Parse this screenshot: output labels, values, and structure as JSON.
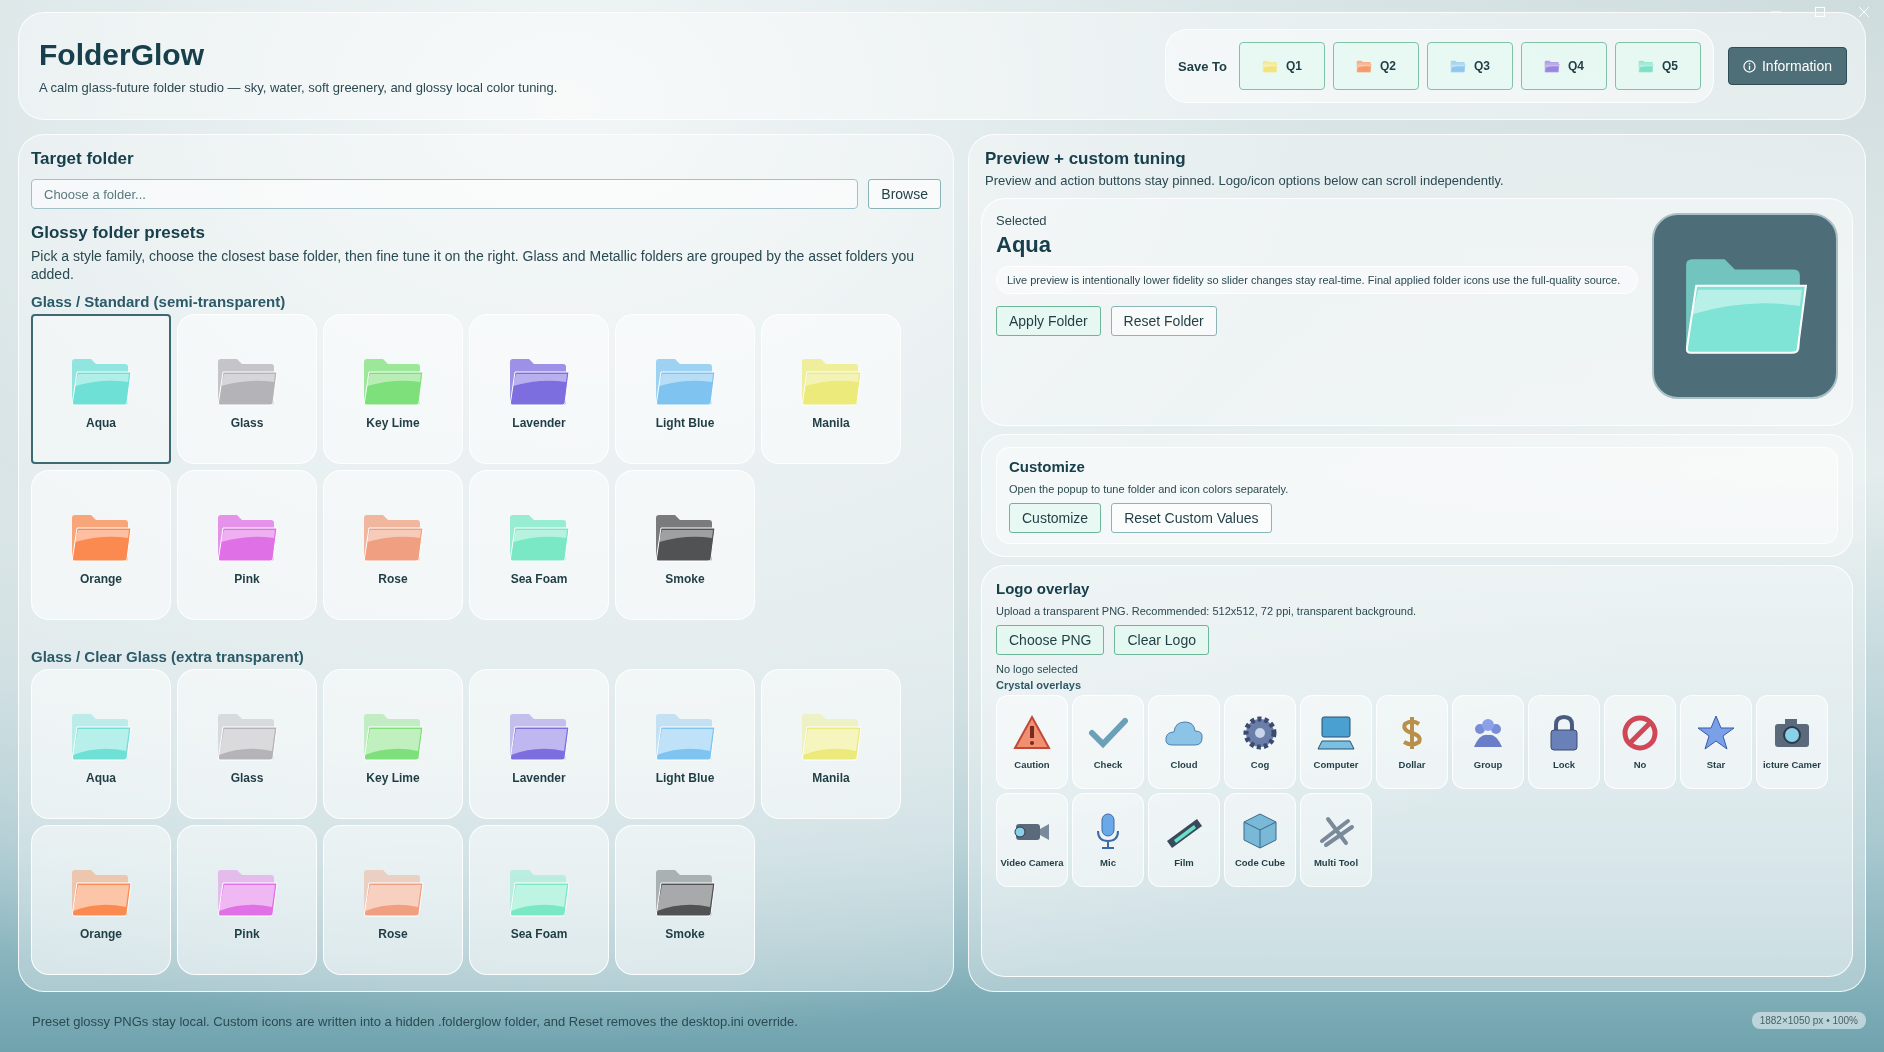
{
  "app": {
    "title": "FolderGlow",
    "subtitle": "A calm glass-future folder studio — sky, water, soft greenery, and glossy local color tuning."
  },
  "save_to": {
    "label": "Save To",
    "slots": [
      {
        "label": "Q1",
        "color": "#f2e37a"
      },
      {
        "label": "Q2",
        "color": "#f59a6a"
      },
      {
        "label": "Q3",
        "color": "#8fc8ec"
      },
      {
        "label": "Q4",
        "color": "#9a86e0"
      },
      {
        "label": "Q5",
        "color": "#7fe0c8"
      }
    ]
  },
  "info_button": "Information",
  "target_folder": {
    "title": "Target folder",
    "placeholder": "Choose a folder...",
    "browse": "Browse"
  },
  "presets": {
    "title": "Glossy folder presets",
    "description": "Pick a style family, choose the closest base folder, then fine tune it on the right. Glass and Metallic folders are grouped by the asset folders you added.",
    "groups": [
      {
        "title": "Glass / Standard (semi-transparent)",
        "kind": "standard",
        "items": [
          {
            "label": "Aqua",
            "color": "#6fe0d6",
            "selected": true
          },
          {
            "label": "Glass",
            "color": "#b4b4b8",
            "selected": false
          },
          {
            "label": "Key Lime",
            "color": "#7ee07a",
            "selected": false
          },
          {
            "label": "Lavender",
            "color": "#7d6ee0",
            "selected": false
          },
          {
            "label": "Light Blue",
            "color": "#7fc4f0",
            "selected": false
          },
          {
            "label": "Manila",
            "color": "#ecea7a",
            "selected": false
          },
          {
            "label": "Orange",
            "color": "#fb8a50",
            "selected": false
          },
          {
            "label": "Pink",
            "color": "#e070e6",
            "selected": false
          },
          {
            "label": "Rose",
            "color": "#f0a080",
            "selected": false
          },
          {
            "label": "Sea Foam",
            "color": "#7ae8c4",
            "selected": false
          },
          {
            "label": "Smoke",
            "color": "#505254",
            "selected": false
          }
        ]
      },
      {
        "title": "Glass / Clear Glass (extra transparent)",
        "kind": "clear",
        "items": [
          {
            "label": "Aqua",
            "color": "#6fe0d6",
            "selected": false
          },
          {
            "label": "Glass",
            "color": "#b4b4b8",
            "selected": false
          },
          {
            "label": "Key Lime",
            "color": "#7ee07a",
            "selected": false
          },
          {
            "label": "Lavender",
            "color": "#7d6ee0",
            "selected": false
          },
          {
            "label": "Light Blue",
            "color": "#7fc4f0",
            "selected": false
          },
          {
            "label": "Manila",
            "color": "#ecea7a",
            "selected": false
          },
          {
            "label": "Orange",
            "color": "#fb8a50",
            "selected": false
          },
          {
            "label": "Pink",
            "color": "#e070e6",
            "selected": false
          },
          {
            "label": "Rose",
            "color": "#f0a080",
            "selected": false
          },
          {
            "label": "Sea Foam",
            "color": "#7ae8c4",
            "selected": false
          },
          {
            "label": "Smoke",
            "color": "#505254",
            "selected": false
          }
        ]
      }
    ]
  },
  "preview": {
    "title": "Preview + custom tuning",
    "description": "Preview and action buttons stay pinned. Logo/icon options below can scroll independently.",
    "selected_label": "Selected",
    "selected_name": "Aqua",
    "note": "Live preview is intentionally lower fidelity so slider changes stay real-time. Final applied folder icons use the full-quality source.",
    "buttons": [
      "Apply Folder",
      "Reset Folder"
    ],
    "color": "#7fe3d6"
  },
  "customize": {
    "title": "Customize",
    "description": "Open the popup to tune folder and icon colors separately.",
    "buttons": [
      "Customize",
      "Reset Custom Values"
    ]
  },
  "logo_overlay": {
    "title": "Logo overlay",
    "description": "Upload a transparent PNG. Recommended: 512x512, 72 ppi, transparent background.",
    "buttons": [
      "Choose PNG",
      "Clear Logo"
    ],
    "status": "No logo selected",
    "overlays_title": "Crystal overlays",
    "overlays": [
      {
        "label": "Caution"
      },
      {
        "label": "Check"
      },
      {
        "label": "Cloud"
      },
      {
        "label": "Cog"
      },
      {
        "label": "Computer"
      },
      {
        "label": "Dollar"
      },
      {
        "label": "Group"
      },
      {
        "label": "Lock"
      },
      {
        "label": "No"
      },
      {
        "label": "Star"
      },
      {
        "label": "icture Camer"
      },
      {
        "label": "Video Camera"
      },
      {
        "label": "Mic"
      },
      {
        "label": "Film"
      },
      {
        "label": "Code Cube"
      },
      {
        "label": "Multi Tool"
      }
    ]
  },
  "footer": "Preset glossy PNGs stay local. Custom icons are written into a hidden .folderglow folder, and Reset removes the desktop.ini override.",
  "zoom_badge": "1882×1050 px • 100%"
}
